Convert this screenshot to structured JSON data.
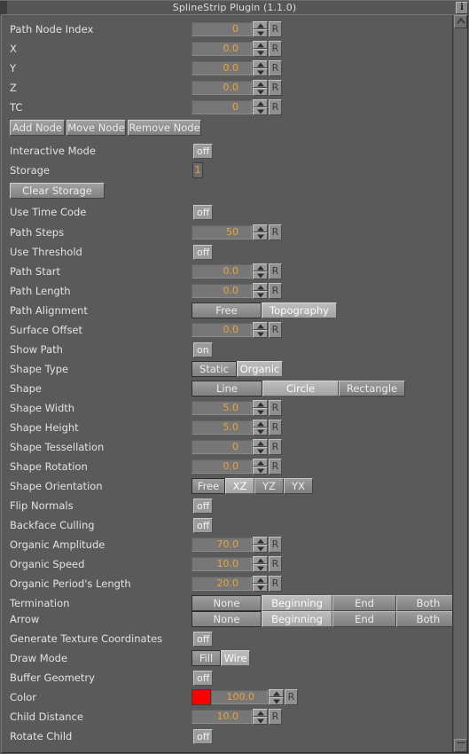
{
  "window": {
    "title": "SplineStrip Plugin (1.1.0)",
    "info_icon": "i"
  },
  "accents": {
    "value_text": "#e8a33d",
    "label_text": "#e2e2e2",
    "panel_bg": "#5a5a5a",
    "color_swatch": "#fd0000"
  },
  "spinner": {
    "reset_label": "R"
  },
  "rows": [
    {
      "label": "Path Node Index",
      "type": "number",
      "value": "0"
    },
    {
      "label": "X",
      "type": "number",
      "value": "0.0"
    },
    {
      "label": "Y",
      "type": "number",
      "value": "0.0"
    },
    {
      "label": "Z",
      "type": "number",
      "value": "0.0"
    },
    {
      "label": "TC",
      "type": "number",
      "value": "0"
    },
    {
      "label": "",
      "type": "buttons",
      "buttons": [
        "Add Node",
        "Move Node",
        "Remove Node"
      ]
    },
    {
      "label": "Interactive Mode",
      "type": "toggle",
      "value": "off"
    },
    {
      "label": "Storage",
      "type": "storage",
      "value": "1"
    },
    {
      "label": "",
      "type": "wide-button",
      "buttons": [
        "Clear Storage"
      ]
    },
    {
      "label": "Use Time Code",
      "type": "toggle",
      "value": "off"
    },
    {
      "label": "Path Steps",
      "type": "number",
      "value": "50"
    },
    {
      "label": "Use Threshold",
      "type": "toggle",
      "value": "off"
    },
    {
      "label": "Path Start",
      "type": "number",
      "value": "0.0"
    },
    {
      "label": "Path Length",
      "type": "number",
      "value": "0.0"
    },
    {
      "label": "Path Alignment",
      "type": "segments",
      "options": [
        "Free",
        "Topography"
      ],
      "selected": 0,
      "lit": 1
    },
    {
      "label": "Surface Offset",
      "type": "number",
      "value": "0.0"
    },
    {
      "label": "Show Path",
      "type": "toggle",
      "value": "on"
    },
    {
      "label": "Shape Type",
      "type": "segments",
      "options": [
        "Static",
        "Organic"
      ],
      "selected": 0,
      "lit": 1
    },
    {
      "label": "Shape",
      "type": "segments",
      "options": [
        "Line",
        "Circle",
        "Rectangle"
      ],
      "selected": 0,
      "lit": 1
    },
    {
      "label": "Shape Width",
      "type": "number",
      "value": "5.0"
    },
    {
      "label": "Shape Height",
      "type": "number",
      "value": "5.0"
    },
    {
      "label": "Shape Tessellation",
      "type": "number",
      "value": "0"
    },
    {
      "label": "Shape Rotation",
      "type": "number",
      "value": "0.0"
    },
    {
      "label": "Shape Orientation",
      "type": "segments",
      "options": [
        "Free",
        "XZ",
        "YZ",
        "YX"
      ],
      "selected": 0,
      "lit": 1
    },
    {
      "label": "Flip Normals",
      "type": "toggle",
      "value": "off"
    },
    {
      "label": "Backface Culling",
      "type": "toggle",
      "value": "off"
    },
    {
      "label": "Organic Amplitude",
      "type": "number",
      "value": "70.0"
    },
    {
      "label": "Organic Speed",
      "type": "number",
      "value": "10.0"
    },
    {
      "label": "Organic Period's Length",
      "type": "number",
      "value": "20.0"
    },
    {
      "label": "Termination",
      "type": "segments",
      "options": [
        "None",
        "Beginning",
        "End",
        "Both"
      ],
      "selected": 0,
      "lit": 1
    },
    {
      "label": "Arrow",
      "type": "segments",
      "options": [
        "None",
        "Beginning",
        "End",
        "Both"
      ],
      "selected": 0,
      "lit": 1
    },
    {
      "label": "Generate Texture Coordinates",
      "type": "toggle",
      "value": "off"
    },
    {
      "label": "Draw Mode",
      "type": "segments",
      "options": [
        "Fill",
        "Wire"
      ],
      "selected": 0,
      "lit": 1
    },
    {
      "label": "Buffer Geometry",
      "type": "toggle",
      "value": "off"
    },
    {
      "label": "Color",
      "type": "color",
      "swatch": "#fd0000",
      "value": "100.0"
    },
    {
      "label": "Child Distance",
      "type": "number",
      "value": "10.0"
    },
    {
      "label": "Rotate Child",
      "type": "toggle",
      "value": "off"
    }
  ]
}
